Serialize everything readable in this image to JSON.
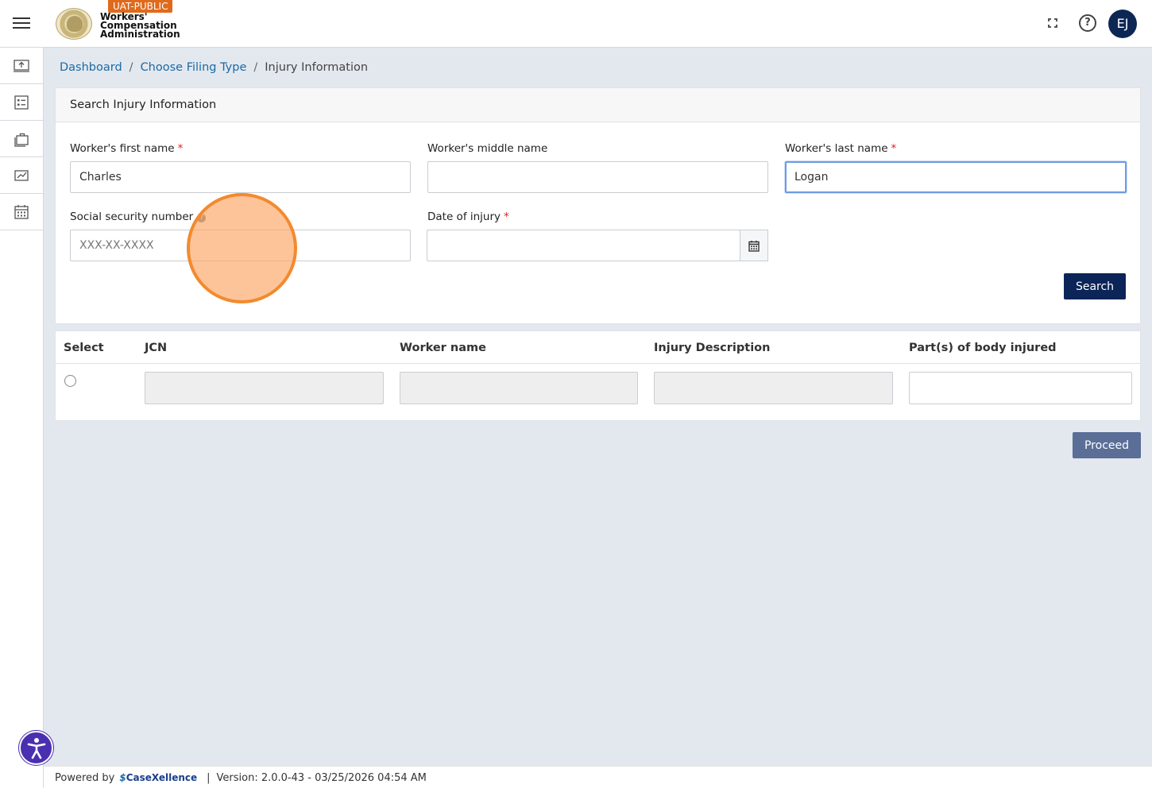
{
  "header": {
    "env_badge": "UAT-PUBLIC",
    "org_line1": "Workers'",
    "org_line2": "Compensation",
    "org_line3": "Administration",
    "help_glyph": "?",
    "avatar_initials": "EJ",
    "icons": [
      "menu-icon",
      "state-seal-logo",
      "fullscreen-icon",
      "help-icon"
    ]
  },
  "sidebar": {
    "items": [
      {
        "icon": "upload-screen-icon"
      },
      {
        "icon": "checklist-icon"
      },
      {
        "icon": "briefcase-icon"
      },
      {
        "icon": "chart-screen-icon"
      },
      {
        "icon": "calendar-icon"
      }
    ]
  },
  "breadcrumb": {
    "items": [
      "Dashboard",
      "Choose Filing Type",
      "Injury Information"
    ],
    "separator": "/"
  },
  "search_form": {
    "title": "Search Injury Information",
    "required_marker": "*",
    "first_name": {
      "label": "Worker's first name",
      "value": "Charles"
    },
    "middle_name": {
      "label": "Worker's middle name",
      "value": ""
    },
    "last_name": {
      "label": "Worker's last name",
      "value": "Logan"
    },
    "ssn": {
      "label": "Social security number",
      "placeholder": "XXX-XX-XXXX",
      "value": ""
    },
    "date_of_injury": {
      "label": "Date of injury",
      "value": ""
    },
    "search_label": "Search"
  },
  "results_table": {
    "columns": [
      "Select",
      "JCN",
      "Worker name",
      "Injury Description",
      "Part(s) of body injured"
    ]
  },
  "actions": {
    "proceed_label": "Proceed"
  },
  "footer": {
    "powered_by": "Powered by",
    "brand": "CaseXellence",
    "separator": "|",
    "version": "Version: 2.0.0-43 - 03/25/2026 04:54 AM"
  },
  "colors": {
    "primary_button": "#0c2558",
    "proceed_button": "#5a6e97",
    "badge": "#e06a1c",
    "link": "#1b6aa5",
    "accessibility": "#4a2fb0"
  }
}
